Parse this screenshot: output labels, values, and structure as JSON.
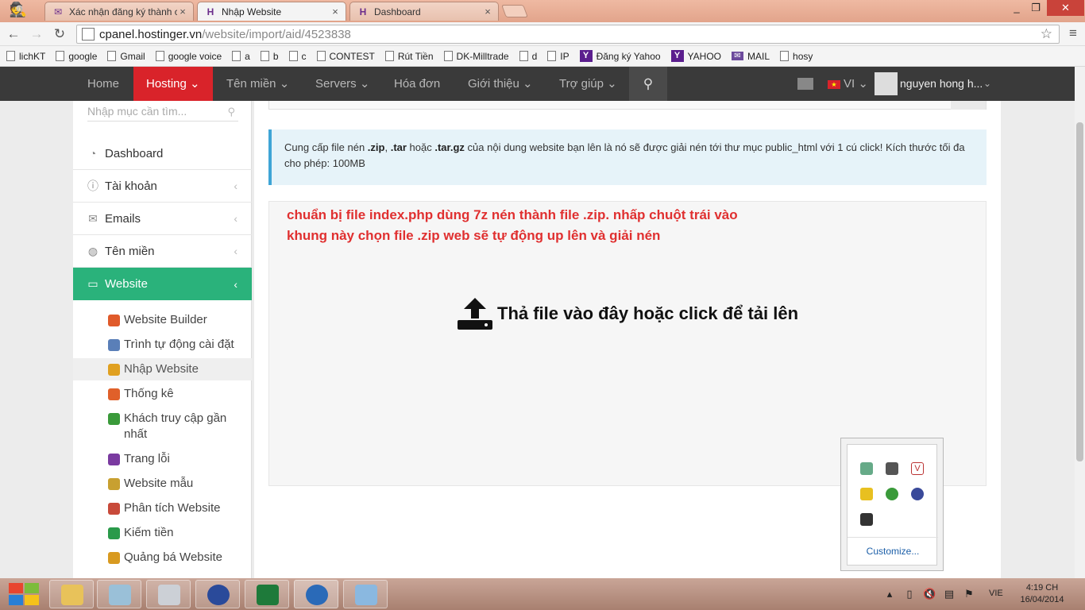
{
  "browser": {
    "tabs": [
      {
        "title": "Xác nhận đăng ký thành c",
        "icon": "mail-icon",
        "active": false
      },
      {
        "title": "Nhập Website",
        "icon": "hostinger-icon",
        "active": true
      },
      {
        "title": "Dashboard",
        "icon": "hostinger-icon",
        "active": false
      }
    ],
    "url_host": "cpanel.hostinger.vn",
    "url_path": "/website/import/aid/4523838",
    "bookmarks": [
      {
        "label": "lichKT",
        "icon": "page"
      },
      {
        "label": "google",
        "icon": "page"
      },
      {
        "label": "Gmail",
        "icon": "page"
      },
      {
        "label": "google voice",
        "icon": "page"
      },
      {
        "label": "a",
        "icon": "page"
      },
      {
        "label": "b",
        "icon": "page"
      },
      {
        "label": "c",
        "icon": "page"
      },
      {
        "label": "CONTEST",
        "icon": "page"
      },
      {
        "label": "Rút Tiền",
        "icon": "page"
      },
      {
        "label": "DK-Milltrade",
        "icon": "page"
      },
      {
        "label": "d",
        "icon": "page"
      },
      {
        "label": "IP",
        "icon": "page"
      },
      {
        "label": "Đăng ký Yahoo",
        "icon": "yahoo"
      },
      {
        "label": "YAHOO",
        "icon": "yahoo"
      },
      {
        "label": "MAIL",
        "icon": "mail"
      },
      {
        "label": "hosy",
        "icon": "page"
      }
    ]
  },
  "topnav": {
    "home": "Home",
    "hosting": "Hosting",
    "domains": "Tên miền",
    "servers": "Servers",
    "invoices": "Hóa đơn",
    "referral": "Giới thiệu",
    "help": "Trợ giúp",
    "lang": "VI",
    "user": "nguyen hong h..."
  },
  "sidebar": {
    "search_placeholder": "Nhập mục cần tìm...",
    "items": [
      {
        "label": "Dashboard",
        "icon": "dashboard-icon"
      },
      {
        "label": "Tài khoản",
        "icon": "info-icon"
      },
      {
        "label": "Emails",
        "icon": "envelope-icon"
      },
      {
        "label": "Tên miền",
        "icon": "globe-icon"
      },
      {
        "label": "Website",
        "icon": "monitor-icon"
      }
    ],
    "subitems": [
      {
        "label": "Website Builder",
        "color": "#e05a2a"
      },
      {
        "label": "Trình tự động cài đặt",
        "color": "#5a7fb8"
      },
      {
        "label": "Nhập Website",
        "color": "#e0a020"
      },
      {
        "label": "Thống kê",
        "color": "#e0602a"
      },
      {
        "label": "Khách truy cập gần nhất",
        "color": "#3a9a3a"
      },
      {
        "label": "Trang lỗi",
        "color": "#7a3aa0"
      },
      {
        "label": "Website mẫu",
        "color": "#c8a030"
      },
      {
        "label": "Phân tích Website",
        "color": "#c84a3a"
      },
      {
        "label": "Kiếm tiền",
        "color": "#2a9a4a"
      },
      {
        "label": "Quảng bá Website",
        "color": "#d89a20"
      }
    ]
  },
  "main": {
    "info_pre": "Cung cấp file nén ",
    "info_zip": ".zip",
    "info_sep": ", ",
    "info_tar": ".tar",
    "info_mid": " hoặc ",
    "info_targz": ".tar.gz",
    "info_post": " của nội dung website bạn lên là nó sẽ được giải nén tới thư mục public_html với 1 cú click! Kích thước tối đa cho phép: 100MB",
    "note": "chuẩn bị file index.php dùng 7z nén thành file .zip. nhấp chuột trái vào khung này chọn file .zip web sẽ tự động up lên và giải nén",
    "drop_text": "Thả file vào đây hoặc click để tải lên"
  },
  "tray_flyout": {
    "customize": "Customize..."
  },
  "taskbar": {
    "language": "VIE",
    "time": "4:19 CH",
    "date": "16/04/2014"
  },
  "colors": {
    "accent_red": "#d9232a",
    "accent_green": "#2ab27b",
    "info_border": "#3fa5d6"
  }
}
